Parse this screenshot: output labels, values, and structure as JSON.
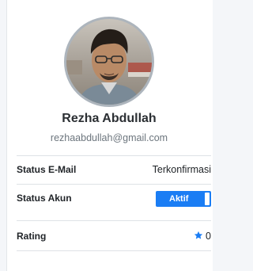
{
  "profile": {
    "name": "Rezha Abdullah",
    "email": "rezhaabdullah@gmail.com"
  },
  "details": {
    "email_status": {
      "label": "Status E-Mail",
      "value": "Terkonfirmasi"
    },
    "account_status": {
      "label": "Status Akun",
      "value": "Aktif"
    },
    "rating": {
      "label": "Rating",
      "value": "0"
    }
  },
  "colors": {
    "accent": "#1a7df4",
    "muted_text": "#6c757d",
    "divider": "#dee2e6"
  },
  "icons": {
    "rating": "star-icon"
  }
}
